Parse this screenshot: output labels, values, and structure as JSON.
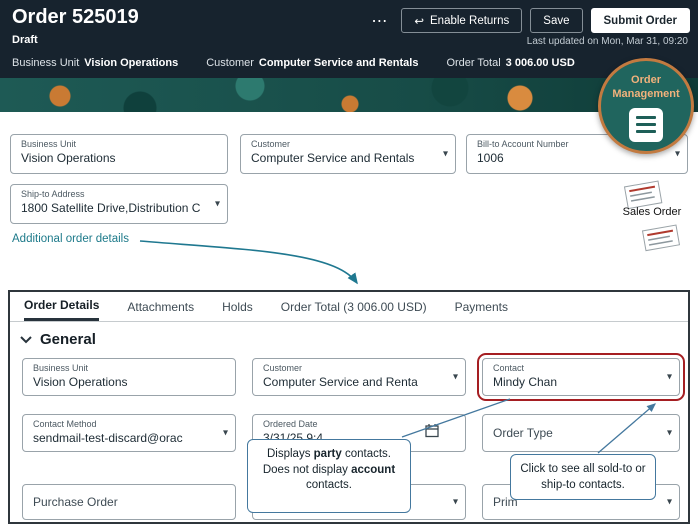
{
  "header": {
    "title": "Order 525019",
    "status": "Draft",
    "last_updated": "Last updated on Mon, Mar 31, 09:20",
    "actions": {
      "enable_returns": "Enable Returns",
      "save": "Save",
      "submit": "Submit Order"
    },
    "info": [
      {
        "label": "Business Unit",
        "value": "Vision Operations"
      },
      {
        "label": "Customer",
        "value": "Computer Service and Rentals"
      },
      {
        "label": "Order Total",
        "value": "3 006.00 USD"
      }
    ]
  },
  "icons": {
    "more": "⋯",
    "return_arrow": "↩",
    "dropdown": "▾"
  },
  "overlays": {
    "order_management": "Order Management",
    "sales_order": "Sales Order"
  },
  "summary_form": {
    "business_unit": {
      "label": "Business Unit",
      "value": "Vision Operations"
    },
    "customer": {
      "label": "Customer",
      "value": "Computer Service and Rentals"
    },
    "bill_to": {
      "label": "Bill-to Account Number",
      "value": "1006"
    },
    "ship_to": {
      "label": "Ship-to Address",
      "value": "1800 Satellite Drive,Distribution C"
    },
    "link": "Additional order details"
  },
  "detail_panel": {
    "tabs": [
      "Order Details",
      "Attachments",
      "Holds",
      "Order Total (3 006.00 USD)",
      "Payments"
    ],
    "active_tab": "Order Details",
    "section_title": "General",
    "fields": {
      "business_unit": {
        "label": "Business Unit",
        "value": "Vision Operations"
      },
      "customer": {
        "label": "Customer",
        "value": "Computer Service and Renta"
      },
      "contact": {
        "label": "Contact",
        "value": "Mindy Chan"
      },
      "contact_method": {
        "label": "Contact Method",
        "value": "sendmail-test-discard@orac"
      },
      "ordered_date": {
        "label": "Ordered Date",
        "value": "3/31/25 9:4"
      },
      "order_type": {
        "label": "Order Type"
      },
      "purchase_order": {
        "label": "Purchase Order"
      },
      "hidden_field": {
        "label": ""
      },
      "primary": {
        "label": "Prim"
      }
    }
  },
  "callouts": {
    "party": {
      "t1": "Displays ",
      "b1": "party",
      "t2": " contacts. Does not display ",
      "b2": "account",
      "t3": " contacts."
    },
    "click_all": "Click to see all sold-to or ship-to contacts."
  }
}
